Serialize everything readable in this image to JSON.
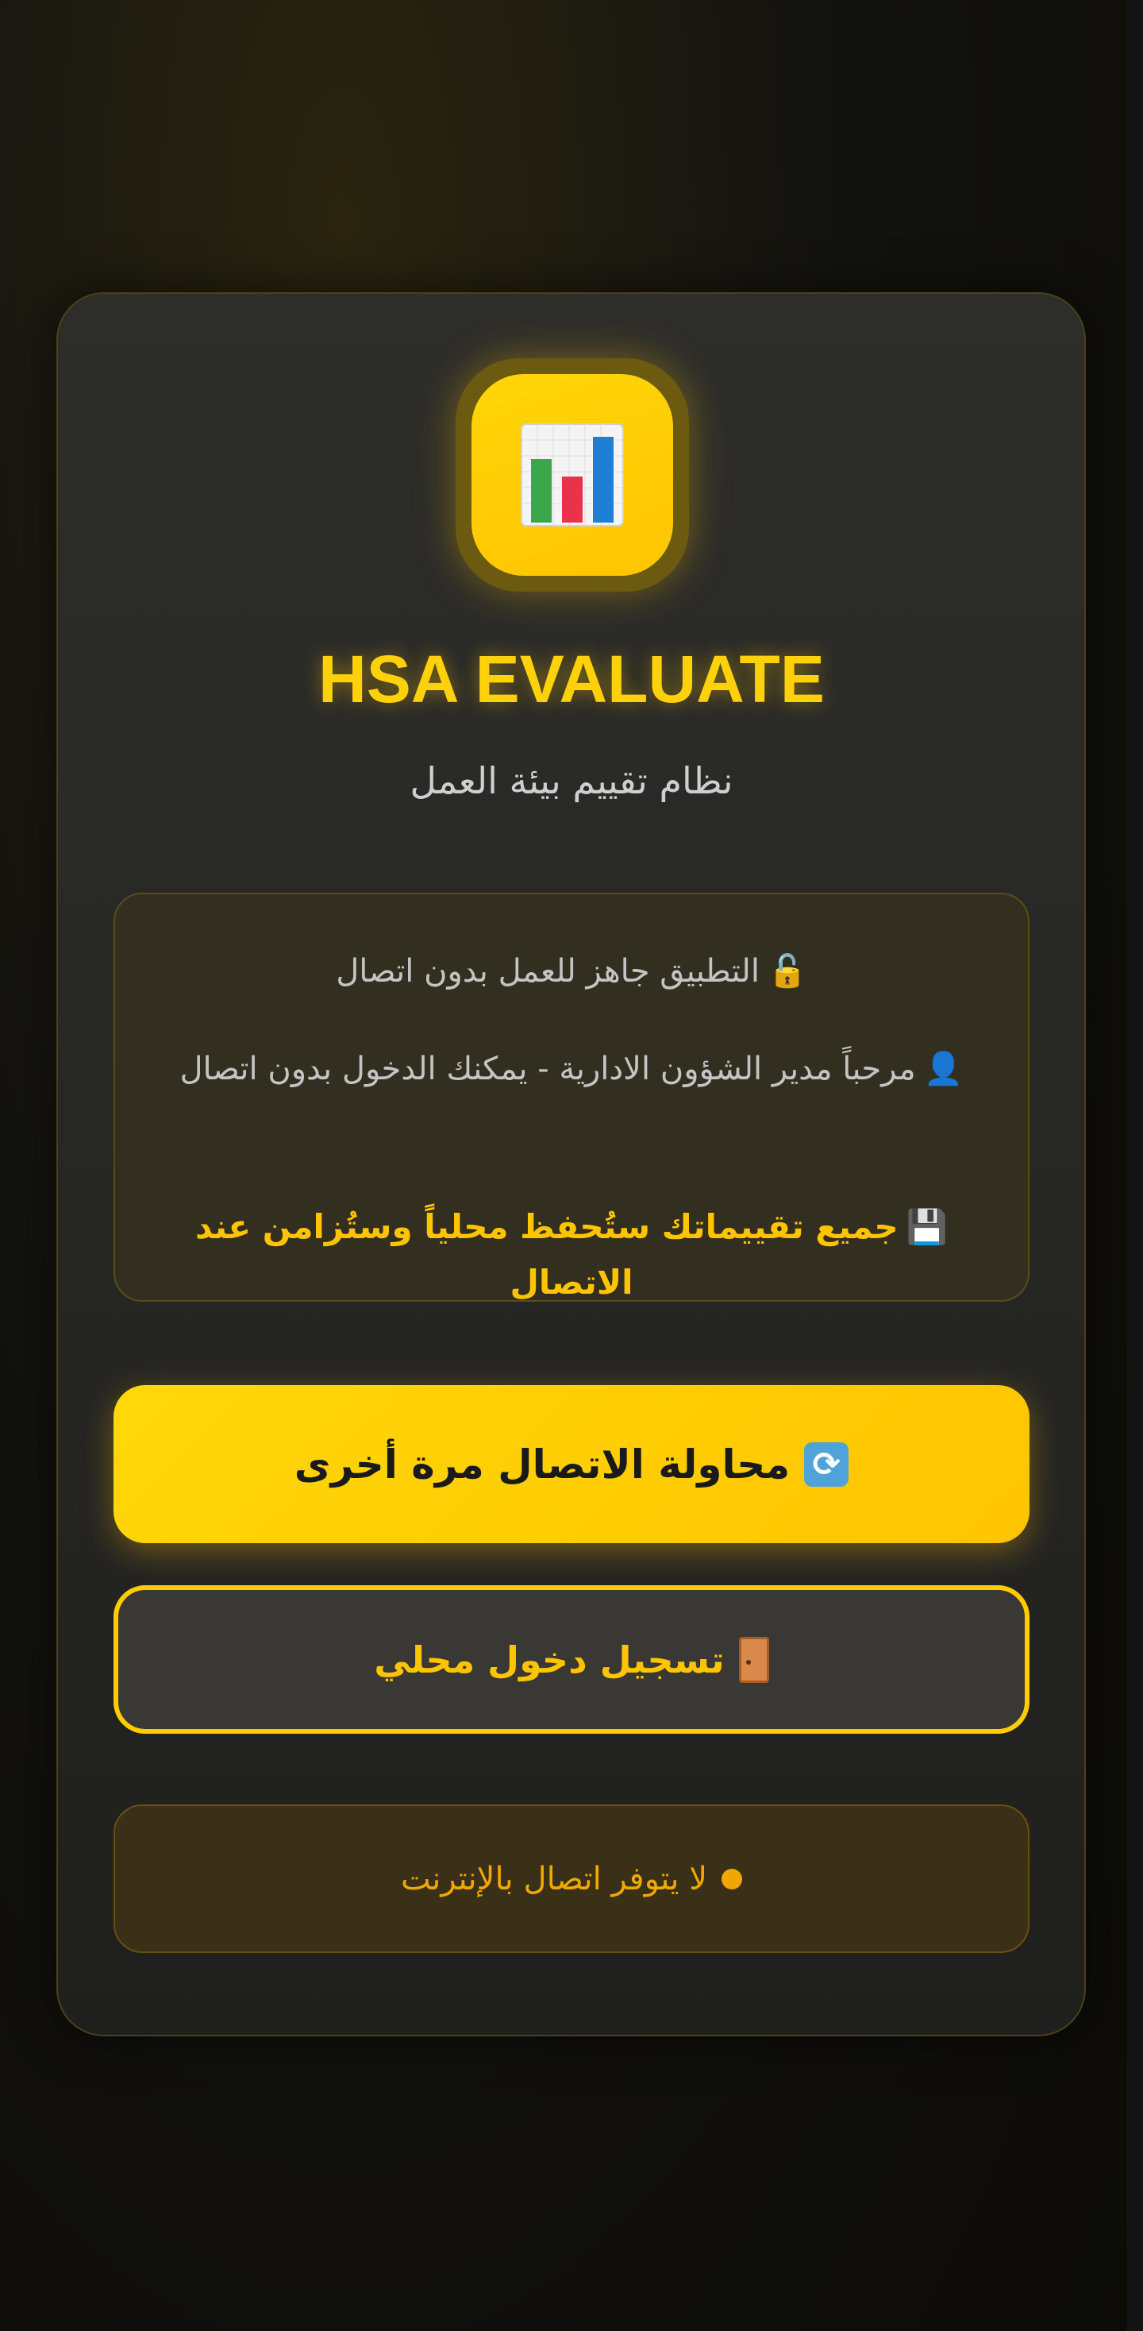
{
  "app": {
    "title": "HSA EVALUATE",
    "subtitle": "نظام تقييم بيئة العمل",
    "logo_icon": "bar-chart-icon"
  },
  "info": {
    "offline_ready": {
      "icon": "🔓",
      "text": "التطبيق جاهز للعمل بدون اتصال"
    },
    "welcome": {
      "icon": "👤",
      "text": "مرحباً مدير الشؤون الادارية - يمكنك الدخول بدون اتصال"
    },
    "sync_notice": {
      "icon": "💾",
      "text": "جميع تقييماتك ستُحفظ محلياً وستُزامن عند الاتصال"
    }
  },
  "buttons": {
    "retry_label": "محاولة الاتصال مرة أخرى",
    "retry_icon": "refresh-icon",
    "local_login_label": "تسجيل دخول محلي",
    "local_login_icon": "door-icon"
  },
  "status": {
    "text": "لا يتوفر اتصال بالإنترنت",
    "color": "#f0a800"
  },
  "colors": {
    "accent": "#ffcc00",
    "background": "#121210"
  }
}
